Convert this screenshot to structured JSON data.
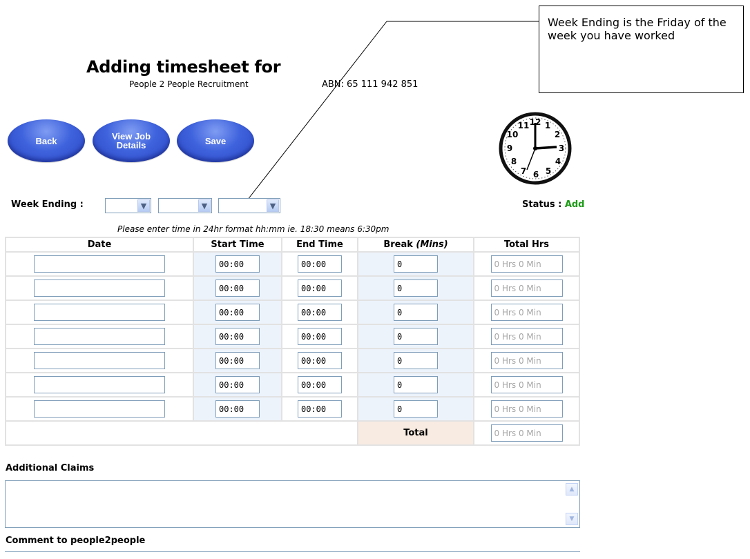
{
  "header": {
    "title": "Adding timesheet for",
    "company": "People 2 People Recruitment",
    "abn": "ABN: 65 111 942 851"
  },
  "buttons": {
    "back": "Back",
    "view_line1": "View Job",
    "view_line2": "Details",
    "save": "Save"
  },
  "callout": {
    "text": "Week Ending is the Friday of the week you have worked"
  },
  "week": {
    "label": "Week Ending :",
    "day": "",
    "month": "",
    "year": ""
  },
  "status": {
    "label": "Status :",
    "value": "Add",
    "color": "#1d9b17"
  },
  "hint": "Please enter time in 24hr format hh:mm ie. 18:30 means 6:30pm",
  "table": {
    "headers": {
      "date": "Date",
      "start": "Start Time",
      "end": "End Time",
      "break_prefix": "Break ",
      "break_unit": "(Mins)",
      "total": "Total Hrs"
    },
    "rows": [
      {
        "date": "",
        "start": "00:00",
        "end": "00:00",
        "break": "0",
        "total": "0 Hrs 0 Min"
      },
      {
        "date": "",
        "start": "00:00",
        "end": "00:00",
        "break": "0",
        "total": "0 Hrs 0 Min"
      },
      {
        "date": "",
        "start": "00:00",
        "end": "00:00",
        "break": "0",
        "total": "0 Hrs 0 Min"
      },
      {
        "date": "",
        "start": "00:00",
        "end": "00:00",
        "break": "0",
        "total": "0 Hrs 0 Min"
      },
      {
        "date": "",
        "start": "00:00",
        "end": "00:00",
        "break": "0",
        "total": "0 Hrs 0 Min"
      },
      {
        "date": "",
        "start": "00:00",
        "end": "00:00",
        "break": "0",
        "total": "0 Hrs 0 Min"
      },
      {
        "date": "",
        "start": "00:00",
        "end": "00:00",
        "break": "0",
        "total": "0 Hrs 0 Min"
      }
    ],
    "total_label": "Total",
    "total_value": "0 Hrs 0 Min"
  },
  "claims": {
    "label": "Additional Claims",
    "value": ""
  },
  "comment": {
    "label": "Comment to people2people"
  },
  "icons": {
    "clock": "clock-icon",
    "select_arrow": "chevron-down-icon",
    "scroll_up": "scroll-up-icon",
    "scroll_down": "scroll-down-icon"
  }
}
